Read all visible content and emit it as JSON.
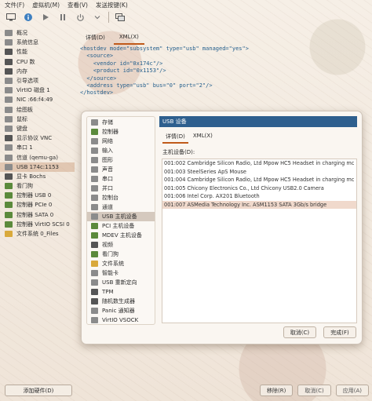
{
  "menu": [
    "文件(F)",
    "虚拟机(M)",
    "查看(V)",
    "发送按键(K)"
  ],
  "toolbar": {
    "icons": [
      "monitor-icon",
      "info-icon",
      "play-icon",
      "pause-icon",
      "power-icon",
      "dropdown-icon",
      "window-icon"
    ]
  },
  "sidebar": {
    "items": [
      {
        "label": "概况",
        "icon": "gray"
      },
      {
        "label": "系统信息",
        "icon": "gray"
      },
      {
        "label": "性能",
        "icon": "dark"
      },
      {
        "label": "CPU 数",
        "icon": "dark"
      },
      {
        "label": "内存",
        "icon": "dark"
      },
      {
        "label": "引导选项",
        "icon": "gray"
      },
      {
        "label": "VirtIO 磁盘 1",
        "icon": "gray"
      },
      {
        "label": "NIC :66:f4:49",
        "icon": "gray"
      },
      {
        "label": "绘图板",
        "icon": "gray"
      },
      {
        "label": "鼠标",
        "icon": "gray"
      },
      {
        "label": "键盘",
        "icon": "gray"
      },
      {
        "label": "显示协议 VNC",
        "icon": "dark"
      },
      {
        "label": "串口 1",
        "icon": "gray"
      },
      {
        "label": "信道 (qemu-ga)",
        "icon": "gray"
      },
      {
        "label": "USB 174c:1153",
        "icon": "gray"
      },
      {
        "label": "显卡 Bochs",
        "icon": "dark"
      },
      {
        "label": "看门狗",
        "icon": "green"
      },
      {
        "label": "控制器 USB 0",
        "icon": "green"
      },
      {
        "label": "控制器 PCIe 0",
        "icon": "green"
      },
      {
        "label": "控制器 SATA 0",
        "icon": "green"
      },
      {
        "label": "控制器 VirtIO SCSI 0",
        "icon": "green"
      },
      {
        "label": "文件系统 0_Files",
        "icon": "yellow"
      }
    ],
    "selected_index": 14,
    "add_hardware": "添加硬件(D)"
  },
  "main": {
    "tabs": [
      "详情(D)",
      "XML(X)"
    ],
    "active_tab": 1,
    "xml_lines": [
      "<hostdev mode=\"subsystem\" type=\"usb\" managed=\"yes\">",
      "  <source>",
      "    <vendor id=\"0x174c\"/>",
      "    <product id=\"0x1153\"/>",
      "  </source>",
      "  <address type=\"usb\" bus=\"0\" port=\"2\"/>",
      "</hostdev>"
    ],
    "buttons": [
      "移除(R)",
      "取消(C)",
      "应用(A)"
    ]
  },
  "dialog": {
    "categories": [
      {
        "label": "存储",
        "icon": "gray"
      },
      {
        "label": "控制器",
        "icon": "green"
      },
      {
        "label": "网络",
        "icon": "gray"
      },
      {
        "label": "输入",
        "icon": "gray"
      },
      {
        "label": "图形",
        "icon": "gray"
      },
      {
        "label": "声音",
        "icon": "gray"
      },
      {
        "label": "串口",
        "icon": "gray"
      },
      {
        "label": "并口",
        "icon": "gray"
      },
      {
        "label": "控制台",
        "icon": "gray"
      },
      {
        "label": "通道",
        "icon": "gray"
      },
      {
        "label": "USB 主机设备",
        "icon": "gray"
      },
      {
        "label": "PCI 主机设备",
        "icon": "green"
      },
      {
        "label": "MDEV 主机设备",
        "icon": "green"
      },
      {
        "label": "视频",
        "icon": "dark"
      },
      {
        "label": "看门狗",
        "icon": "green"
      },
      {
        "label": "文件系统",
        "icon": "yellow"
      },
      {
        "label": "智能卡",
        "icon": "gray"
      },
      {
        "label": "USB 重新定向",
        "icon": "gray"
      },
      {
        "label": "TPM",
        "icon": "dark"
      },
      {
        "label": "随机数生成器",
        "icon": "dark"
      },
      {
        "label": "Panic 通知器",
        "icon": "gray"
      },
      {
        "label": "VirtIO VSOCK",
        "icon": "gray"
      }
    ],
    "selected_category": 10,
    "header": "USB 设备",
    "tabs": [
      "详情(D)",
      "XML(X)"
    ],
    "active_tab": 0,
    "device_label": "主机设备(D):",
    "devices": [
      "001:002 Cambridge Silicon Radio, Ltd Mpow HC5 Headset in charging mc",
      "001:003 SteelSeries ApS Mouse",
      "001:004 Cambridge Silicon Radio, Ltd Mpow HC5 Headset in charging mc",
      "001:005 Chicony Electronics Co., Ltd Chicony USB2.0 Camera",
      "001:006 Intel Corp. AX201 Bluetooth",
      "001:007 ASMedia Technology Inc. ASM1153 SATA 3Gb/s bridge"
    ],
    "selected_device": 5,
    "cancel": "取消(C)",
    "finish": "完成(F)"
  }
}
